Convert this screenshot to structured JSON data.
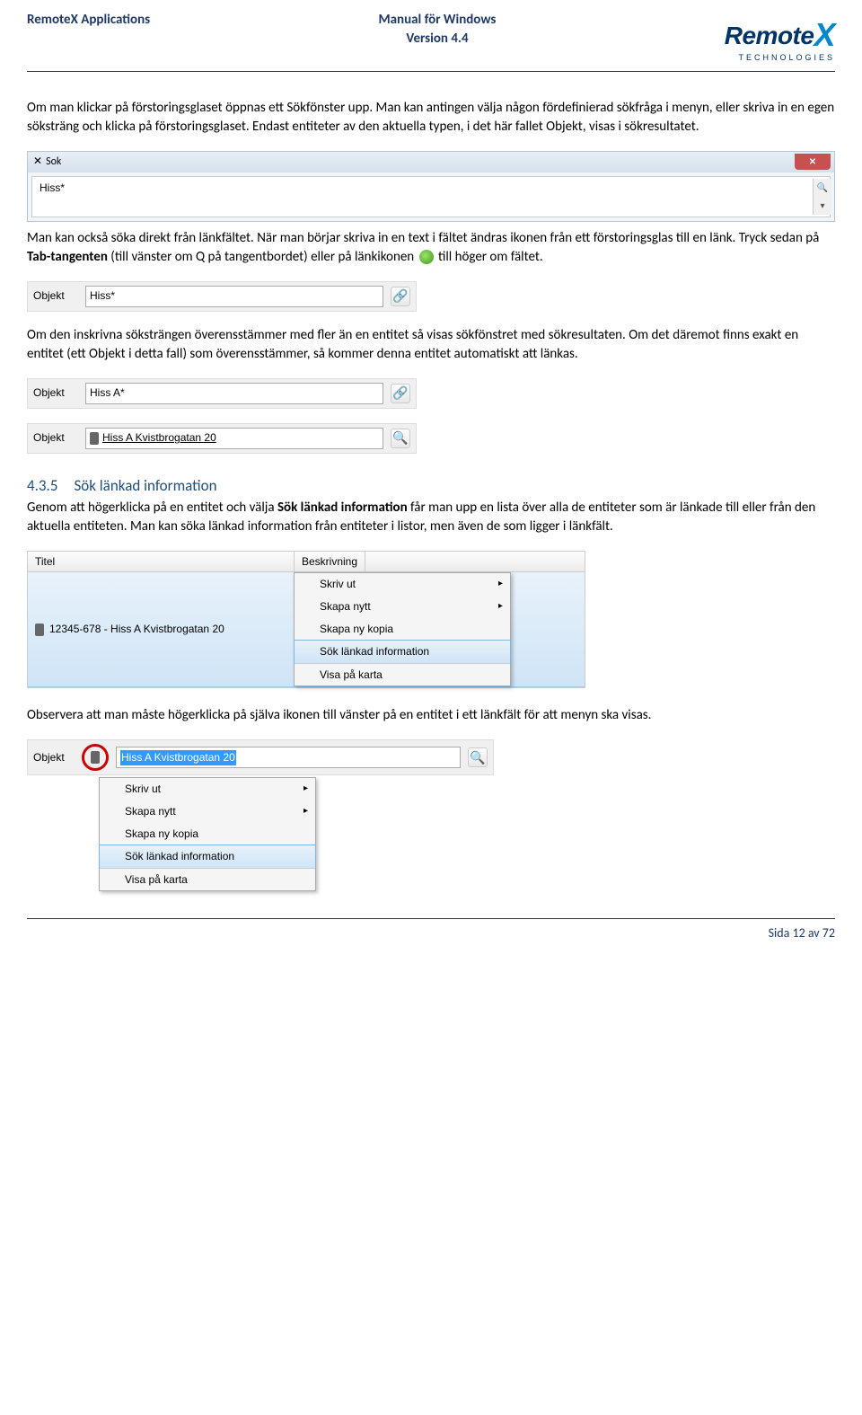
{
  "header": {
    "left": "RemoteX Applications",
    "center_line1": "Manual för Windows",
    "center_line2": "Version 4.4",
    "logo_main": "Remote",
    "logo_x": "X",
    "logo_sub": "TECHNOLOGIES"
  },
  "body": {
    "p1": "Om man klickar på förstoringsglaset öppnas ett Sökfönster upp. Man kan antingen välja någon fördefinierad sökfråga i menyn, eller skriva in en egen söksträng och klicka på förstoringsglaset. Endast entiteter av den aktuella typen, i det här fallet Objekt, visas i sökresultatet.",
    "sok_window_title": "Sok",
    "sok_window_value": "Hiss*",
    "p2a": "Man kan också söka direkt från länkfältet. När man börjar skriva in en text i fältet ändras ikonen från ett förstoringsglas till en länk. Tryck sedan på ",
    "p2b_bold": "Tab-tangenten",
    "p2c": " (till vänster om Q på tangentbordet) eller på länkikonen ",
    "p2d": " till höger om fältet.",
    "field1_label": "Objekt",
    "field1_value": "Hiss*",
    "p3": "Om den inskrivna söksträngen överensstämmer med fler än en entitet så visas sökfönstret med sökresultaten. Om det däremot finns exakt en entitet (ett Objekt i detta fall) som överensstämmer, så kommer denna entitet automatiskt att länkas.",
    "field2_label": "Objekt",
    "field2_value": "Hiss A*",
    "field3_label": "Objekt",
    "field3_value": "Hiss A Kvistbrogatan 20",
    "section_num": "4.3.5",
    "section_title": "Sök länkad information",
    "p4a": "Genom att högerklicka på en entitet och välja ",
    "p4b_bold": "Sök länkad information",
    "p4c": " får man upp en lista över alla de entiteter som är länkade till eller från den aktuella entiteten. Man kan söka länkad information från entiteter i listor, men även de som ligger i länkfält.",
    "table_col1": "Titel",
    "table_col2": "Beskrivning",
    "table_row1": "12345-678 - Hiss A Kvistbrogatan 20",
    "menu": {
      "m1": "Skriv ut",
      "m2": "Skapa nytt",
      "m3": "Skapa ny kopia",
      "m4": "Sök länkad information",
      "m5": "Visa på karta"
    },
    "p5": "Observera att man måste högerklicka på själva ikonen till vänster på en entitet i ett länkfält för att menyn ska visas.",
    "lf_label": "Objekt",
    "lf_value": "Hiss A Kvistbrogatan 20"
  },
  "footer": {
    "text": "Sida 12 av 72"
  }
}
